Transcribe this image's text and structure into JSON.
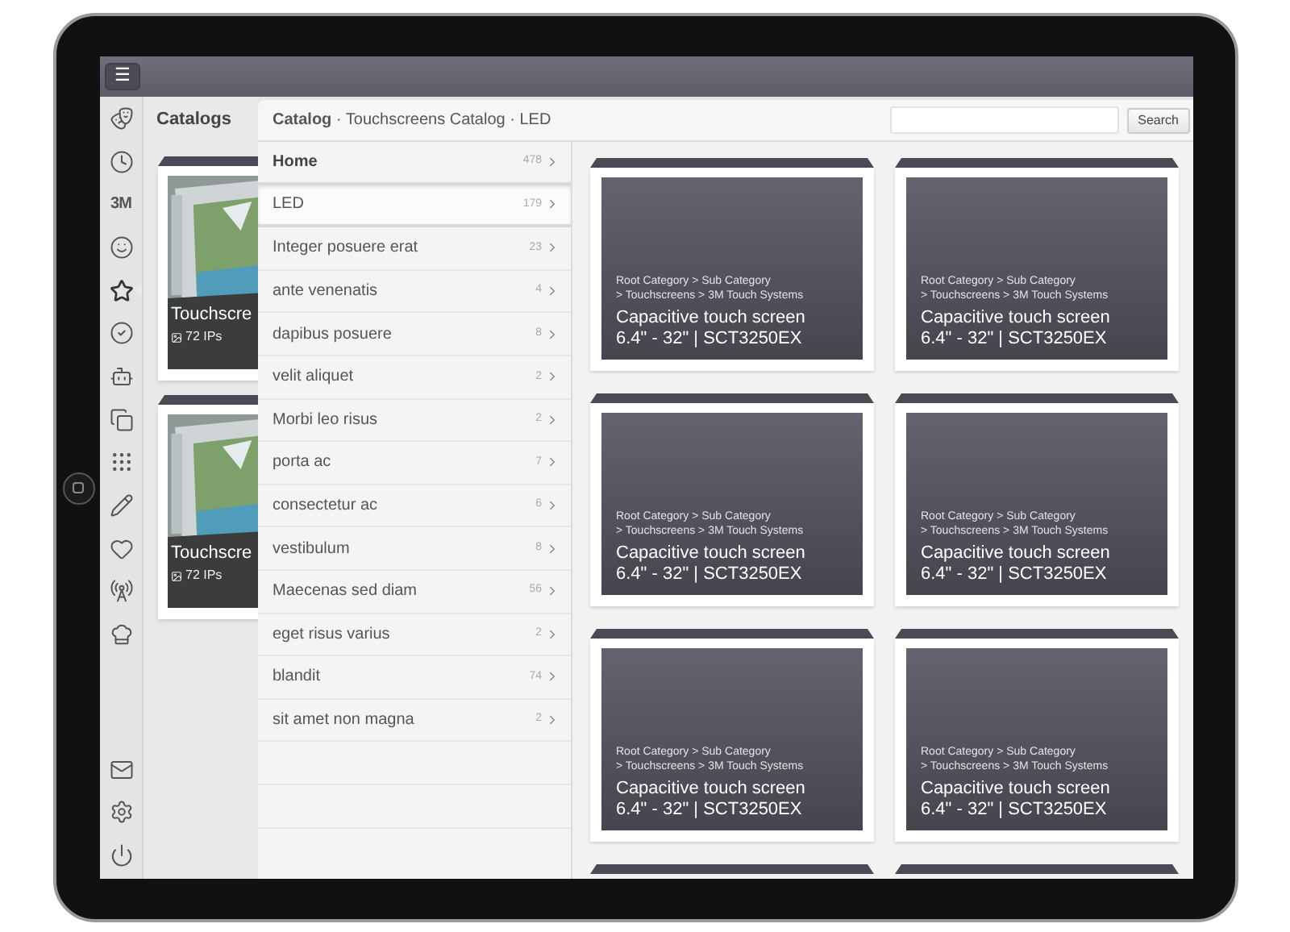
{
  "topbar": {
    "menu_button": "☰"
  },
  "rail": {
    "items": [
      {
        "selected": false
      },
      {
        "selected": false
      },
      {
        "label": "3M",
        "selected": false
      },
      {
        "selected": false
      },
      {
        "selected": true
      },
      {
        "selected": false
      },
      {
        "selected": false
      },
      {
        "selected": false
      },
      {
        "selected": false
      },
      {
        "selected": false
      },
      {
        "selected": false
      },
      {
        "selected": false
      },
      {
        "selected": false
      }
    ],
    "bottom_items": [
      {
        "selected": false
      },
      {
        "selected": false
      },
      {
        "selected": false
      }
    ]
  },
  "catalogs": {
    "title": "Catalogs",
    "cards": [
      {
        "title": "Touchscre",
        "count": "72 IPs"
      },
      {
        "title": "Touchscre",
        "count": "72 IPs"
      }
    ]
  },
  "breadcrumb": "**Catalog** · Touchscreens Catalog · LED",
  "search": {
    "button": "Search"
  },
  "nav": [
    {
      "kind": "home",
      "label": "Home",
      "count": "478",
      "selected": false
    },
    {
      "kind": "current",
      "label": "LED",
      "count": "179",
      "selected": true
    },
    {
      "kind": "item",
      "label": "Integer posuere erat",
      "count": "23",
      "selected": false
    },
    {
      "kind": "item",
      "label": "ante venenatis",
      "count": "4",
      "selected": false
    },
    {
      "kind": "item",
      "label": "dapibus posuere",
      "count": "8",
      "selected": false
    },
    {
      "kind": "item",
      "label": "velit aliquet",
      "count": "2",
      "selected": false
    },
    {
      "kind": "item",
      "label": "Morbi leo risus",
      "count": "2",
      "selected": false
    },
    {
      "kind": "item",
      "label": "porta ac",
      "count": "7",
      "selected": false
    },
    {
      "kind": "item",
      "label": "consectetur ac",
      "count": "6",
      "selected": false
    },
    {
      "kind": "item",
      "label": "vestibulum",
      "count": "8",
      "selected": false
    },
    {
      "kind": "item",
      "label": "Maecenas sed diam",
      "count": "56",
      "selected": false
    },
    {
      "kind": "item",
      "label": "eget risus varius",
      "count": "2",
      "selected": false
    },
    {
      "kind": "item",
      "label": "blandit",
      "count": "74",
      "selected": false
    },
    {
      "kind": "item",
      "label": "sit amet non magna",
      "count": "2",
      "selected": false
    }
  ],
  "products": [
    {
      "path": [
        "Root Category > Sub Category",
        "> Touchscreens > 3M Touch Systems"
      ],
      "title": [
        "Capacitive touch screen",
        "6.4\" - 32\" | SCT3250EX"
      ]
    },
    {
      "path": [
        "Root Category > Sub Category",
        "> Touchscreens > 3M Touch Systems"
      ],
      "title": [
        "Capacitive touch screen",
        "6.4\" - 32\" | SCT3250EX"
      ]
    },
    {
      "path": [
        "Root Category > Sub Category",
        "> Touchscreens > 3M Touch Systems"
      ],
      "title": [
        "Capacitive touch screen",
        "6.4\" - 32\" | SCT3250EX"
      ]
    },
    {
      "path": [
        "Root Category > Sub Category",
        "> Touchscreens > 3M Touch Systems"
      ],
      "title": [
        "Capacitive touch screen",
        "6.4\" - 32\" | SCT3250EX"
      ]
    },
    {
      "path": [
        "Root Category > Sub Category",
        "> Touchscreens > 3M Touch Systems"
      ],
      "title": [
        "Capacitive touch screen",
        "6.4\" - 32\" | SCT3250EX"
      ]
    },
    {
      "path": [
        "Root Category > Sub Category",
        "> Touchscreens > 3M Touch Systems"
      ],
      "title": [
        "Capacitive touch screen",
        "6.4\" - 32\" | SCT3250EX"
      ]
    }
  ]
}
